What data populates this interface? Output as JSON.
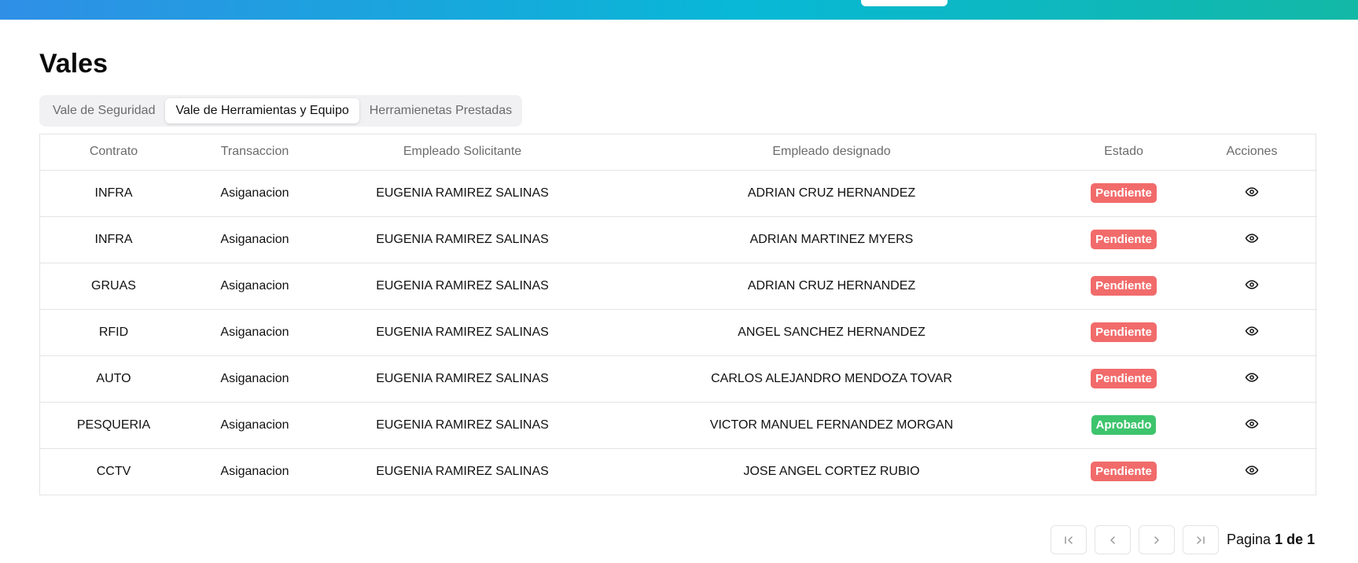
{
  "page": {
    "title": "Vales"
  },
  "tabs": [
    {
      "label": "Vale de Seguridad",
      "active": false
    },
    {
      "label": "Vale de Herramientas y Equipo",
      "active": true
    },
    {
      "label": "Herramienetas Prestadas",
      "active": false
    }
  ],
  "table": {
    "headers": [
      "Contrato",
      "Transaccion",
      "Empleado Solicitante",
      "Empleado designado",
      "Estado",
      "Acciones"
    ],
    "rows": [
      {
        "contrato": "INFRA",
        "transaccion": "Asiganacion",
        "solicitante": "EUGENIA RAMIREZ SALINAS",
        "designado": "ADRIAN CRUZ HERNANDEZ",
        "estado": "Pendiente",
        "action_icon": "eye-icon"
      },
      {
        "contrato": "INFRA",
        "transaccion": "Asiganacion",
        "solicitante": "EUGENIA RAMIREZ SALINAS",
        "designado": "ADRIAN MARTINEZ MYERS",
        "estado": "Pendiente",
        "action_icon": "eye-icon"
      },
      {
        "contrato": "GRUAS",
        "transaccion": "Asiganacion",
        "solicitante": "EUGENIA RAMIREZ SALINAS",
        "designado": "ADRIAN CRUZ HERNANDEZ",
        "estado": "Pendiente",
        "action_icon": "eye-icon"
      },
      {
        "contrato": "RFID",
        "transaccion": "Asiganacion",
        "solicitante": "EUGENIA RAMIREZ SALINAS",
        "designado": "ANGEL SANCHEZ HERNANDEZ",
        "estado": "Pendiente",
        "action_icon": "eye-icon"
      },
      {
        "contrato": "AUTO",
        "transaccion": "Asiganacion",
        "solicitante": "EUGENIA RAMIREZ SALINAS",
        "designado": "CARLOS ALEJANDRO MENDOZA TOVAR",
        "estado": "Pendiente",
        "action_icon": "eye-icon"
      },
      {
        "contrato": "PESQUERIA",
        "transaccion": "Asiganacion",
        "solicitante": "EUGENIA RAMIREZ SALINAS",
        "designado": "VICTOR MANUEL FERNANDEZ MORGAN",
        "estado": "Aprobado",
        "action_icon": "eye-icon"
      },
      {
        "contrato": "CCTV",
        "transaccion": "Asiganacion",
        "solicitante": "EUGENIA RAMIREZ SALINAS",
        "designado": "JOSE ANGEL CORTEZ RUBIO",
        "estado": "Pendiente",
        "action_icon": "eye-icon"
      }
    ]
  },
  "status_colors": {
    "Pendiente": "#f26b6b",
    "Aprobado": "#3ec46d"
  },
  "pagination": {
    "prefix": "Pagina",
    "current_label": "1 de 1",
    "buttons": [
      "first-page-icon",
      "prev-page-icon",
      "next-page-icon",
      "last-page-icon"
    ]
  },
  "theme": {
    "header_gradient": [
      "#2f8fe6",
      "#08b8d6",
      "#13b8a6"
    ]
  }
}
